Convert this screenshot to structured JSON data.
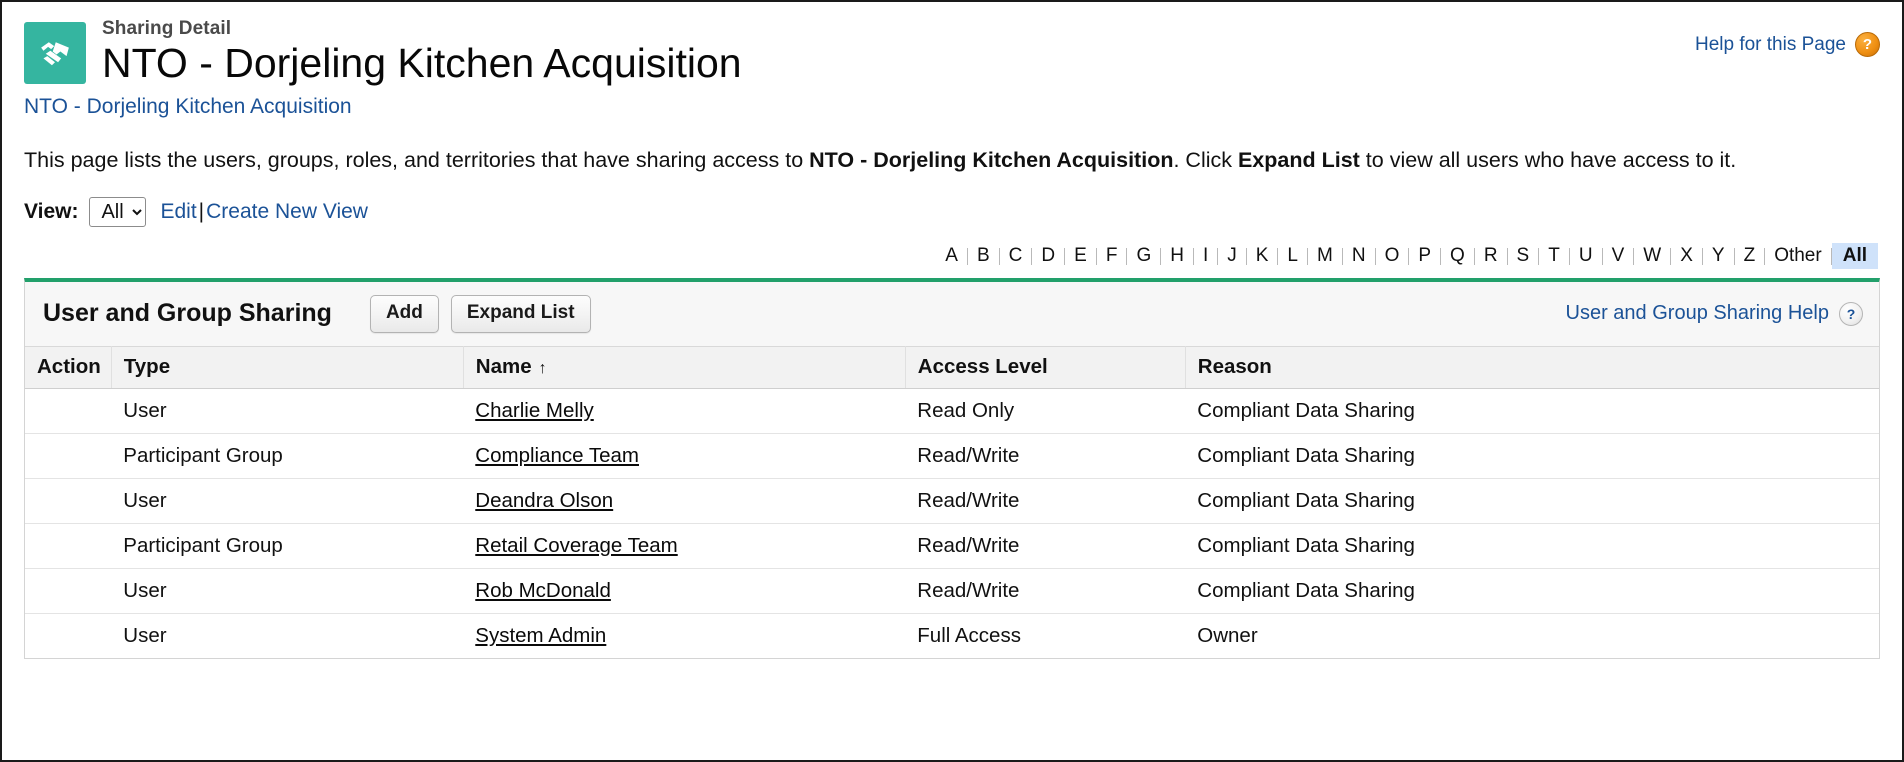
{
  "header": {
    "eyebrow": "Sharing Detail",
    "title": "NTO - Dorjeling Kitchen Acquisition",
    "object_icon": "handshake-icon",
    "icon_color": "#35b5a0",
    "help_link": "Help for this Page",
    "help_icon_glyph": "?",
    "breadcrumb": "NTO - Dorjeling Kitchen Acquisition"
  },
  "intro": {
    "part1": "This page lists the users, groups, roles, and territories that have sharing access to ",
    "record_name": "NTO - Dorjeling Kitchen Acquisition",
    "part2": ". Click ",
    "action_name": "Expand List",
    "part3": " to view all users who have access to it."
  },
  "view": {
    "label": "View:",
    "selected": "All",
    "options": [
      "All"
    ],
    "edit_link": "Edit",
    "separator": "|",
    "create_link": "Create New View"
  },
  "alpha_filter": {
    "letters": [
      "A",
      "B",
      "C",
      "D",
      "E",
      "F",
      "G",
      "H",
      "I",
      "J",
      "K",
      "L",
      "M",
      "N",
      "O",
      "P",
      "Q",
      "R",
      "S",
      "T",
      "U",
      "V",
      "W",
      "X",
      "Y",
      "Z",
      "Other",
      "All"
    ],
    "active": "All",
    "active_bg": "#cfe2fa"
  },
  "panel": {
    "title": "User and Group Sharing",
    "accent_color": "#22a06b",
    "buttons": [
      {
        "label": "Add",
        "name": "add-button"
      },
      {
        "label": "Expand List",
        "name": "expand-list-button"
      }
    ],
    "help_link": "User and Group Sharing Help",
    "help_icon_glyph": "?"
  },
  "table": {
    "columns": [
      "Action",
      "Type",
      "Name",
      "Access Level",
      "Reason"
    ],
    "sort_column": "Name",
    "sort_direction": "ascending",
    "sort_caret": "↑",
    "rows": [
      {
        "action": "",
        "type": "User",
        "name": "Charlie Melly",
        "access": "Read Only",
        "reason": "Compliant Data Sharing"
      },
      {
        "action": "",
        "type": "Participant Group",
        "name": "Compliance Team",
        "access": "Read/Write",
        "reason": "Compliant Data Sharing"
      },
      {
        "action": "",
        "type": "User",
        "name": "Deandra Olson",
        "access": "Read/Write",
        "reason": "Compliant Data Sharing"
      },
      {
        "action": "",
        "type": "Participant Group",
        "name": "Retail Coverage Team",
        "access": "Read/Write",
        "reason": "Compliant Data Sharing"
      },
      {
        "action": "",
        "type": "User",
        "name": "Rob McDonald",
        "access": "Read/Write",
        "reason": "Compliant Data Sharing"
      },
      {
        "action": "",
        "type": "User",
        "name": "System Admin",
        "access": "Full Access",
        "reason": "Owner"
      }
    ]
  }
}
